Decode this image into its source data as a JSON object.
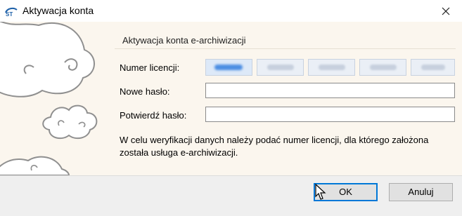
{
  "window": {
    "title": "Aktywacja konta",
    "app_icon": "app-logo-icon",
    "close_icon": "close-icon"
  },
  "form": {
    "section_title": "Aktywacja konta e-archiwizacji",
    "license_label": "Numer licencji:",
    "license_parts": [
      "",
      "",
      "",
      "",
      ""
    ],
    "new_password_label": "Nowe hasło:",
    "new_password_value": "",
    "confirm_password_label": "Potwierdź hasło:",
    "confirm_password_value": "",
    "info_text": "W celu weryfikacji danych należy podać numer licencji, dla którego założona została usługa e-archiwizacji."
  },
  "footer": {
    "ok_label": "OK",
    "cancel_label": "Anuluj"
  },
  "colors": {
    "content_bg": "#fbf6ee",
    "accent": "#0078d7"
  }
}
